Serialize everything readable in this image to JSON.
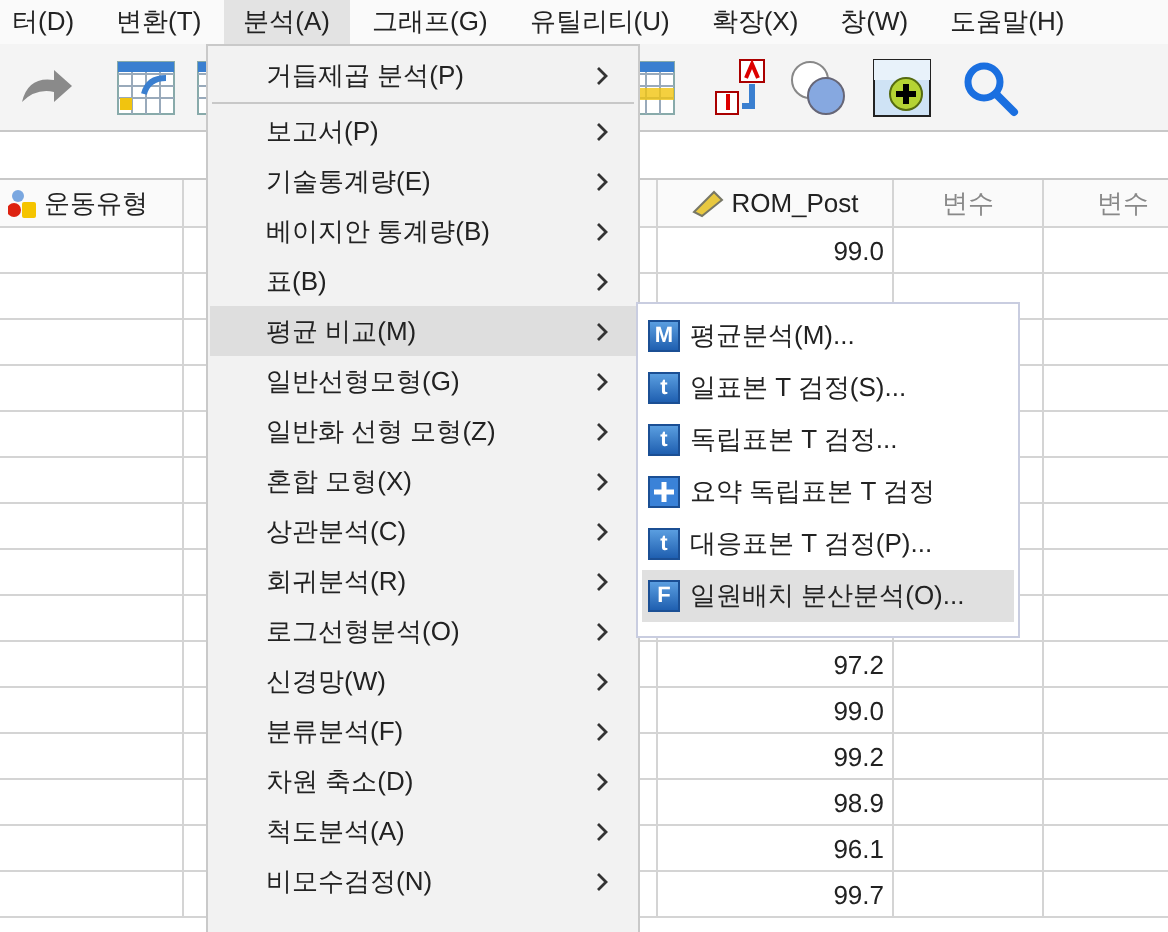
{
  "menu_bar": [
    {
      "label": "터(D)",
      "selected": false
    },
    {
      "label": "변환(T)",
      "selected": false
    },
    {
      "label": "분석(A)",
      "selected": true
    },
    {
      "label": "그래프(G)",
      "selected": false
    },
    {
      "label": "유틸리티(U)",
      "selected": false
    },
    {
      "label": "확장(X)",
      "selected": false
    },
    {
      "label": "창(W)",
      "selected": false
    },
    {
      "label": "도움말(H)",
      "selected": false
    }
  ],
  "table": {
    "columns": [
      {
        "header": "운동유형",
        "kind": "nominal"
      },
      {
        "kind": "blank"
      },
      {
        "kind": "blank"
      },
      {
        "header": "ROM_Post",
        "kind": "scale"
      },
      {
        "header": "변수",
        "kind": "empty"
      },
      {
        "header": "변수",
        "kind": "empty"
      }
    ],
    "rows": [
      {
        "column_4": "99.0"
      },
      {},
      {},
      {},
      {},
      {},
      {},
      {},
      {},
      {
        "column_4": "97.2"
      },
      {
        "column_4": "99.0"
      },
      {
        "column_4": "99.2"
      },
      {
        "column_4": "98.9"
      },
      {
        "column_4": "96.1"
      },
      {
        "column_4": "99.7"
      }
    ]
  },
  "analyze_menu": [
    {
      "kind": "item",
      "label": "거듭제곱 분석(P)",
      "has_submenu": true,
      "selected": false
    },
    {
      "kind": "separator"
    },
    {
      "kind": "item",
      "label": "보고서(P)",
      "has_submenu": true,
      "selected": false
    },
    {
      "kind": "item",
      "label": "기술통계량(E)",
      "has_submenu": true,
      "selected": false
    },
    {
      "kind": "item",
      "label": "베이지안 통계량(B)",
      "has_submenu": true,
      "selected": false
    },
    {
      "kind": "item",
      "label": "표(B)",
      "has_submenu": true,
      "selected": false
    },
    {
      "kind": "item",
      "label": "평균 비교(M)",
      "has_submenu": true,
      "selected": true
    },
    {
      "kind": "item",
      "label": "일반선형모형(G)",
      "has_submenu": true,
      "selected": false
    },
    {
      "kind": "item",
      "label": "일반화 선형 모형(Z)",
      "has_submenu": true,
      "selected": false
    },
    {
      "kind": "item",
      "label": "혼합 모형(X)",
      "has_submenu": true,
      "selected": false
    },
    {
      "kind": "item",
      "label": "상관분석(C)",
      "has_submenu": true,
      "selected": false
    },
    {
      "kind": "item",
      "label": "회귀분석(R)",
      "has_submenu": true,
      "selected": false
    },
    {
      "kind": "item",
      "label": "로그선형분석(O)",
      "has_submenu": true,
      "selected": false
    },
    {
      "kind": "item",
      "label": "신경망(W)",
      "has_submenu": true,
      "selected": false
    },
    {
      "kind": "item",
      "label": "분류분석(F)",
      "has_submenu": true,
      "selected": false
    },
    {
      "kind": "item",
      "label": "차원 축소(D)",
      "has_submenu": true,
      "selected": false
    },
    {
      "kind": "item",
      "label": "척도분석(A)",
      "has_submenu": true,
      "selected": false
    },
    {
      "kind": "item",
      "label": "비모수검정(N)",
      "has_submenu": true,
      "selected": false
    }
  ],
  "compare_means_submenu": [
    {
      "label": "평균분석(M)...",
      "kind": "letter",
      "icon_text": "M",
      "selected": false
    },
    {
      "label": "일표본 T 검정(S)...",
      "kind": "letter",
      "icon_text": "t",
      "selected": false
    },
    {
      "label": "독립표본 T 검정...",
      "kind": "letter",
      "icon_text": "t",
      "selected": false
    },
    {
      "label": "요약 독립표본 T 검정",
      "kind": "plus",
      "selected": false
    },
    {
      "label": "대응표본 T 검정(P)...",
      "kind": "letter",
      "icon_text": "t",
      "selected": false
    },
    {
      "label": "일원배치 분산분석(O)...",
      "kind": "letter",
      "icon_text": "F",
      "selected": true
    }
  ]
}
